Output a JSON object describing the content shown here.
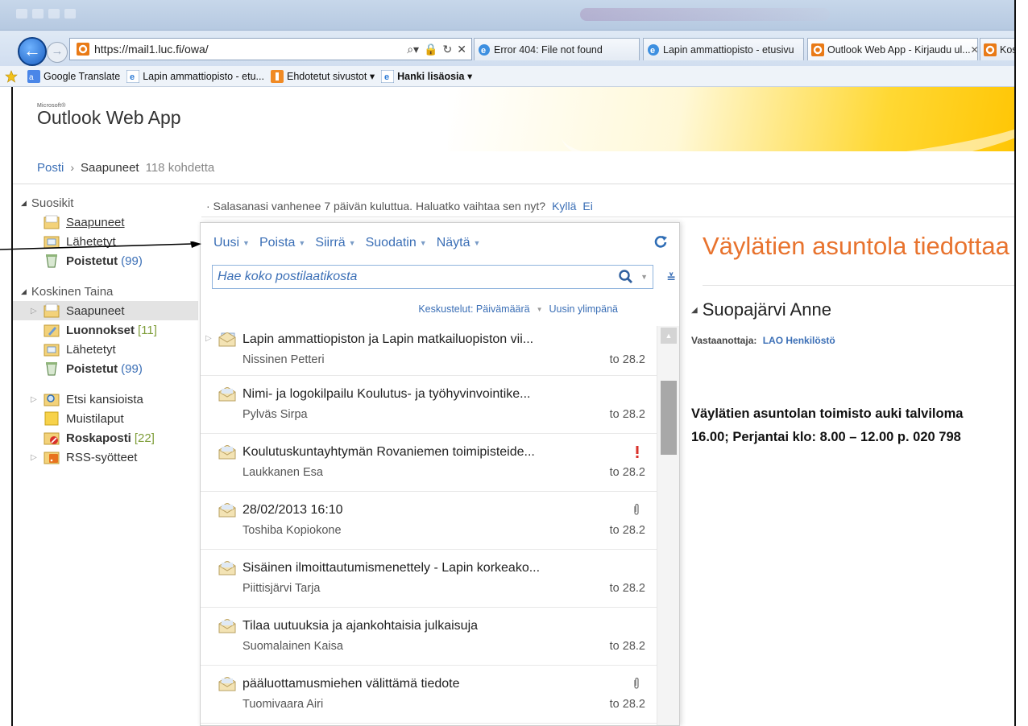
{
  "browser": {
    "url": "https://mail1.luc.fi/owa/",
    "tabs": [
      {
        "label": "Error 404: File not found"
      },
      {
        "label": "Lapin ammattiopisto - etusivu"
      },
      {
        "label": "Outlook Web App - Kirjaudu ul..."
      },
      {
        "label": "Kos"
      }
    ],
    "favorites": [
      {
        "label": "Google Translate"
      },
      {
        "label": "Lapin ammattiopisto - etu..."
      },
      {
        "label": "Ehdotetut sivustot ▾"
      },
      {
        "label": "Hanki lisäosia ▾"
      }
    ]
  },
  "app": {
    "brand_small": "Microsoft®",
    "brand": "Outlook Web App"
  },
  "breadcrumb": {
    "root": "Posti",
    "separator": "›",
    "current": "Saapuneet",
    "count": "118 kohdetta"
  },
  "sidebar": {
    "favorites_header": "Suosikit",
    "favorites": [
      {
        "label": "Saapuneet"
      },
      {
        "label": "Lähetetyt"
      },
      {
        "label": "Poistetut",
        "count": "(99)"
      }
    ],
    "mailbox_header": "Koskinen Taina",
    "mailbox": [
      {
        "label": "Saapuneet"
      },
      {
        "label": "Luonnokset",
        "count": "[11]"
      },
      {
        "label": "Lähetetyt"
      },
      {
        "label": "Poistetut",
        "count": "(99)"
      }
    ],
    "other": [
      {
        "label": "Etsi kansioista"
      },
      {
        "label": "Muistilaput"
      },
      {
        "label": "Roskaposti",
        "count": "[22]"
      },
      {
        "label": "RSS-syötteet"
      }
    ]
  },
  "notice": {
    "text": "· Salasanasi vanhenee 7 päivän kuluttua. Haluatko vaihtaa sen nyt?",
    "yes": "Kyllä",
    "no": "Ei"
  },
  "toolbar": {
    "new": "Uusi",
    "delete": "Poista",
    "move": "Siirrä",
    "filter": "Suodatin",
    "view": "Näytä"
  },
  "search": {
    "placeholder": "Hae koko postilaatikosta"
  },
  "sort": {
    "by": "Keskustelut: Päivämäärä",
    "order": "Uusin ylimpänä"
  },
  "messages": [
    {
      "subject": "Lapin ammattiopiston ja Lapin matkailuopiston vii...",
      "from": "Nissinen Petteri",
      "date": "to 28.2",
      "flag": ""
    },
    {
      "subject": "Nimi- ja logokilpailu Koulutus- ja työhyvinvointike...",
      "from": "Pylväs Sirpa",
      "date": "to 28.2",
      "flag": ""
    },
    {
      "subject": "Koulutuskuntayhtymän Rovaniemen toimipisteide...",
      "from": "Laukkanen Esa",
      "date": "to 28.2",
      "flag": "!"
    },
    {
      "subject": "28/02/2013 16:10",
      "from": "Toshiba Kopiokone",
      "date": "to 28.2",
      "flag": "attachment"
    },
    {
      "subject": "Sisäinen ilmoittautumismenettely - Lapin korkeako...",
      "from": "Piittisjärvi Tarja",
      "date": "to 28.2",
      "flag": ""
    },
    {
      "subject": "Tilaa uutuuksia ja ajankohtaisia julkaisuja",
      "from": "Suomalainen Kaisa",
      "date": "to 28.2",
      "flag": ""
    },
    {
      "subject": "pääluottamusmiehen välittämä tiedote",
      "from": "Tuomivaara Airi",
      "date": "to 28.2",
      "flag": "attachment"
    }
  ],
  "reading": {
    "subject": "Väylätien asuntola tiedottaa",
    "sender": "Suopajärvi Anne",
    "to_label": "Vastaanottaja:",
    "to_value": "LAO Henkilöstö",
    "body_line1": "Väylätien asuntolan toimisto auki talviloma",
    "body_line2": "16.00;  Perjantai klo: 8.00 – 12.00  p. 020 798"
  },
  "colors": {
    "accent": "#3b6fb6",
    "subject_orange": "#e8732e",
    "count_green": "#7f9e3a"
  }
}
